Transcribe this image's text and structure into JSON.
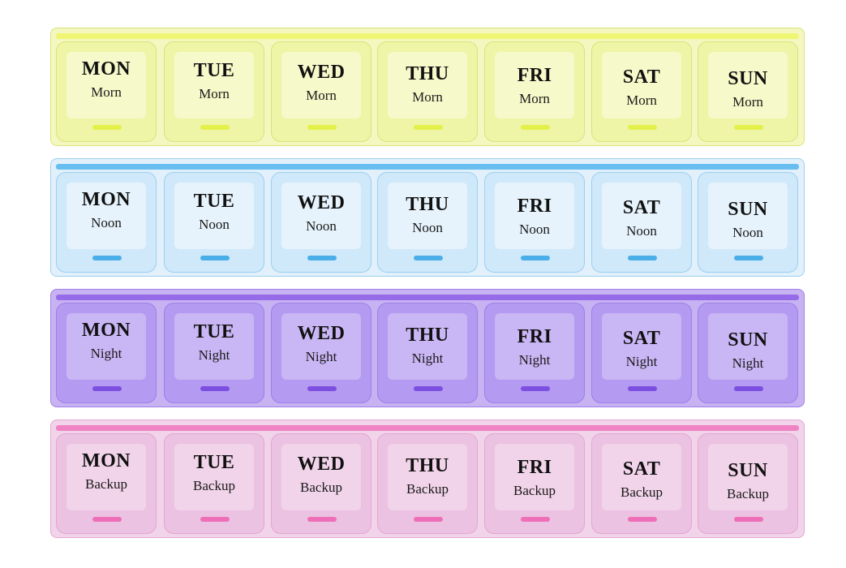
{
  "organizer": {
    "rows": [
      {
        "slot": "Morn",
        "colors": {
          "body": "#f4f7bf",
          "lid": "#eef5a6",
          "inner": "#f6f9c9",
          "rim": "#eef56a",
          "tab": "#e4f04a",
          "edge": "#d8e47a"
        },
        "days": [
          "MON",
          "TUE",
          "WED",
          "THU",
          "FRI",
          "SAT",
          "SUN"
        ]
      },
      {
        "slot": "Noon",
        "colors": {
          "body": "#e1f0fb",
          "lid": "#cfe8fa",
          "inner": "#e6f3fc",
          "rim": "#5bb8ef",
          "tab": "#4aaee8",
          "edge": "#9cd0ef"
        },
        "days": [
          "MON",
          "TUE",
          "WED",
          "THU",
          "FRI",
          "SAT",
          "SUN"
        ]
      },
      {
        "slot": "Night",
        "colors": {
          "body": "#c7b3f2",
          "lid": "#b49af0",
          "inner": "#c9b6f4",
          "rim": "#8f63e6",
          "tab": "#7c4fe0",
          "edge": "#9f7fe9"
        },
        "days": [
          "MON",
          "TUE",
          "WED",
          "THU",
          "FRI",
          "SAT",
          "SUN"
        ]
      },
      {
        "slot": "Backup",
        "colors": {
          "body": "#f1d3ea",
          "lid": "#ebc2e1",
          "inner": "#f2d4ea",
          "rim": "#f07ac0",
          "tab": "#ee6fb8",
          "edge": "#e5a6d2"
        },
        "days": [
          "MON",
          "TUE",
          "WED",
          "THU",
          "FRI",
          "SAT",
          "SUN"
        ]
      }
    ]
  }
}
